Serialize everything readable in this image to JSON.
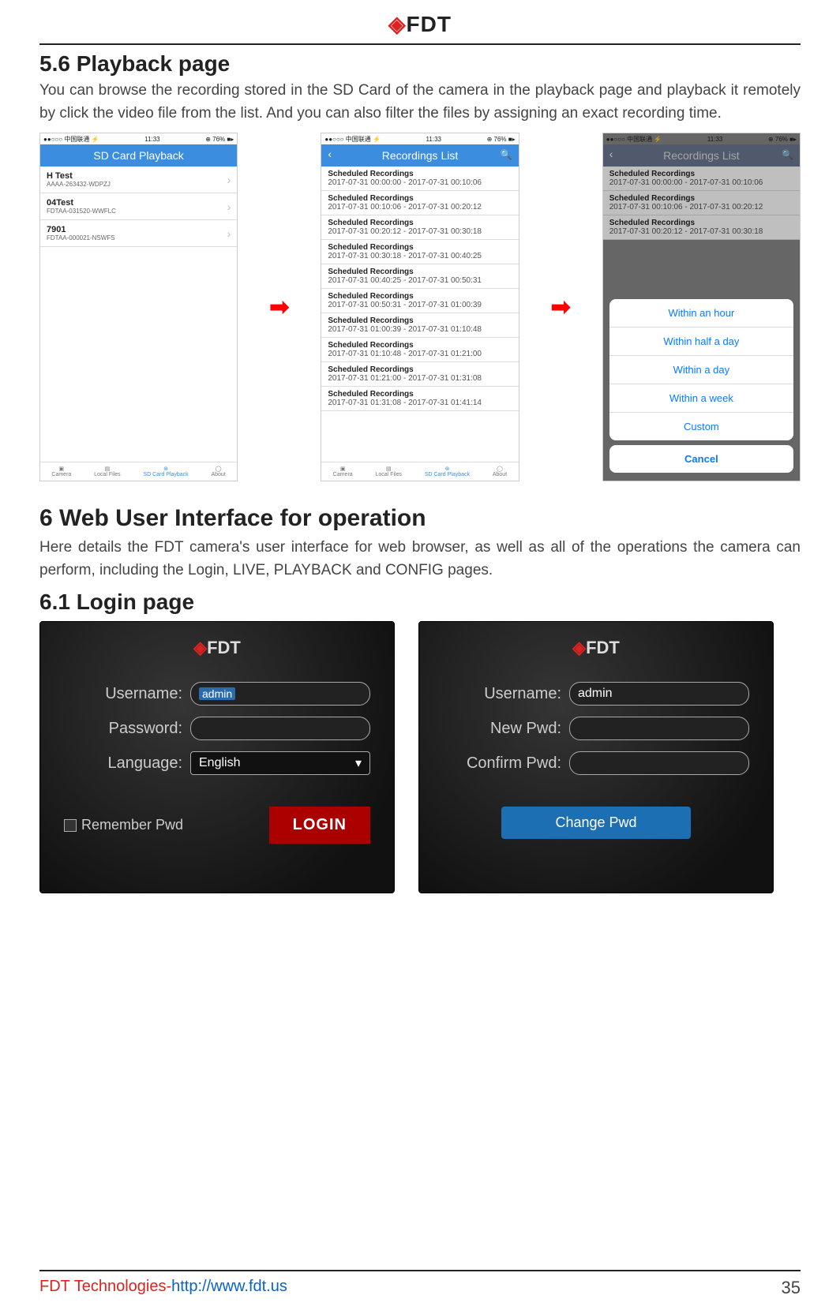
{
  "header": {
    "brand": "FDT"
  },
  "section56": {
    "title": "5.6 Playback page",
    "text": "You can browse the recording stored in the SD Card of the camera in the playback page and playback it remotely by click the video file from the list. And you can also filter the files by assigning an exact recording time."
  },
  "phone_status": {
    "carrier": "中国联通",
    "time": "11:33",
    "battery": "76%"
  },
  "phone1": {
    "header": "SD Card Playback",
    "devices": [
      {
        "name": "H Test",
        "id": "AAAA-263432-WDPZJ"
      },
      {
        "name": "04Test",
        "id": "FDTAA-031520-WWFLC"
      },
      {
        "name": "7901",
        "id": "FDTAA-000021-NSWFS"
      }
    ]
  },
  "phone2": {
    "header": "Recordings List",
    "item_title": "Scheduled Recordings",
    "items": [
      "2017-07-31 00:00:00 - 2017-07-31 00:10:06",
      "2017-07-31 00:10:06 - 2017-07-31 00:20:12",
      "2017-07-31 00:20:12 - 2017-07-31 00:30:18",
      "2017-07-31 00:30:18 - 2017-07-31 00:40:25",
      "2017-07-31 00:40:25 - 2017-07-31 00:50:31",
      "2017-07-31 00:50:31 - 2017-07-31 01:00:39",
      "2017-07-31 01:00:39 - 2017-07-31 01:10:48",
      "2017-07-31 01:10:48 - 2017-07-31 01:21:00",
      "2017-07-31 01:21:00 - 2017-07-31 01:31:08",
      "2017-07-31 01:31:08 - 2017-07-31 01:41:14"
    ]
  },
  "phone3": {
    "header": "Recordings List",
    "item_title": "Scheduled Recordings",
    "items": [
      "2017-07-31 00:00:00 - 2017-07-31 00:10:06",
      "2017-07-31 00:10:06 - 2017-07-31 00:20:12",
      "2017-07-31 00:20:12 - 2017-07-31 00:30:18"
    ],
    "options": [
      "Within an hour",
      "Within half a day",
      "Within a day",
      "Within a week",
      "Custom"
    ],
    "cancel": "Cancel"
  },
  "tabbar": {
    "camera": "Camera",
    "local": "Local Files",
    "sd": "SD Card Playback",
    "about": "About"
  },
  "section6": {
    "title": "6 Web User Interface for operation",
    "text": "Here details the FDT camera's user interface for web browser, as well as all of the operations the camera can perform, including the Login, LIVE, PLAYBACK and CONFIG pages."
  },
  "section61": {
    "title": "6.1 Login page"
  },
  "login_panel": {
    "brand": "FDT",
    "username_label": "Username:",
    "username_value": "admin",
    "password_label": "Password:",
    "language_label": "Language:",
    "language_value": "English",
    "remember": "Remember Pwd",
    "login_btn": "LOGIN"
  },
  "change_panel": {
    "brand": "FDT",
    "username_label": "Username:",
    "username_value": "admin",
    "newpwd_label": "New Pwd:",
    "confirmpwd_label": "Confirm Pwd:",
    "change_btn": "Change Pwd"
  },
  "footer": {
    "brand": "FDT Technologies-",
    "url": "http://www.fdt.us",
    "page": "35"
  }
}
